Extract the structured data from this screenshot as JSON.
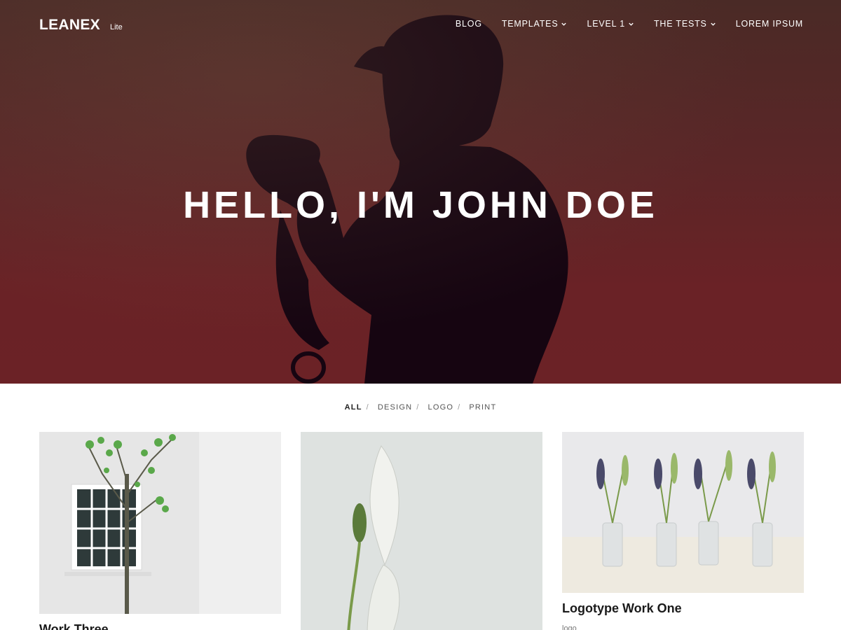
{
  "brand": {
    "name": "LEANEX",
    "tag": "Lite"
  },
  "nav": {
    "items": [
      {
        "label": "BLOG",
        "has_dropdown": false
      },
      {
        "label": "TEMPLATES",
        "has_dropdown": true
      },
      {
        "label": "LEVEL 1",
        "has_dropdown": true
      },
      {
        "label": "THE TESTS",
        "has_dropdown": true
      },
      {
        "label": "LOREM IPSUM",
        "has_dropdown": false
      }
    ]
  },
  "hero": {
    "title": "HELLO, I'M JOHN DOE"
  },
  "filters": {
    "items": [
      "ALL",
      "DESIGN",
      "LOGO",
      "PRINT"
    ],
    "active": "ALL",
    "separator": "/"
  },
  "portfolio": [
    {
      "title": "Work Three",
      "category": ""
    },
    {
      "title": "",
      "category": ""
    },
    {
      "title": "Logotype Work One",
      "category": "logo"
    }
  ],
  "colors": {
    "hero_top": "#4a2a26",
    "hero_bottom": "#6b2226",
    "accent_text": "#ffffff"
  }
}
